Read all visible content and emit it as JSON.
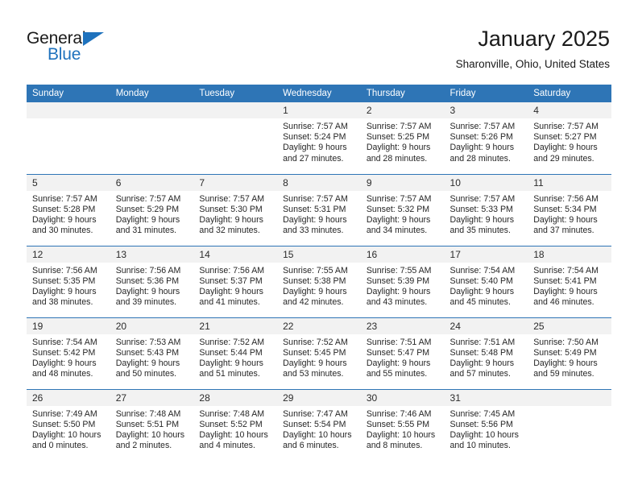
{
  "logo": {
    "word_one": "General",
    "word_two": "Blue",
    "triangle_color": "#1f72bd"
  },
  "header": {
    "title": "January 2025",
    "location": "Sharonville, Ohio, United States"
  },
  "theme": {
    "header_blue": "#2e75b6",
    "daynum_bg": "#f2f2f2",
    "text": "#262626"
  },
  "columns": [
    "Sunday",
    "Monday",
    "Tuesday",
    "Wednesday",
    "Thursday",
    "Friday",
    "Saturday"
  ],
  "weeks": [
    [
      {
        "day": "",
        "empty": true,
        "sunrise": "",
        "sunset": "",
        "daylight_1": "",
        "daylight_2": ""
      },
      {
        "day": "",
        "empty": true,
        "sunrise": "",
        "sunset": "",
        "daylight_1": "",
        "daylight_2": ""
      },
      {
        "day": "",
        "empty": true,
        "sunrise": "",
        "sunset": "",
        "daylight_1": "",
        "daylight_2": ""
      },
      {
        "day": "1",
        "sunrise": "Sunrise: 7:57 AM",
        "sunset": "Sunset: 5:24 PM",
        "daylight_1": "Daylight: 9 hours",
        "daylight_2": "and 27 minutes."
      },
      {
        "day": "2",
        "sunrise": "Sunrise: 7:57 AM",
        "sunset": "Sunset: 5:25 PM",
        "daylight_1": "Daylight: 9 hours",
        "daylight_2": "and 28 minutes."
      },
      {
        "day": "3",
        "sunrise": "Sunrise: 7:57 AM",
        "sunset": "Sunset: 5:26 PM",
        "daylight_1": "Daylight: 9 hours",
        "daylight_2": "and 28 minutes."
      },
      {
        "day": "4",
        "sunrise": "Sunrise: 7:57 AM",
        "sunset": "Sunset: 5:27 PM",
        "daylight_1": "Daylight: 9 hours",
        "daylight_2": "and 29 minutes."
      }
    ],
    [
      {
        "day": "5",
        "sunrise": "Sunrise: 7:57 AM",
        "sunset": "Sunset: 5:28 PM",
        "daylight_1": "Daylight: 9 hours",
        "daylight_2": "and 30 minutes."
      },
      {
        "day": "6",
        "sunrise": "Sunrise: 7:57 AM",
        "sunset": "Sunset: 5:29 PM",
        "daylight_1": "Daylight: 9 hours",
        "daylight_2": "and 31 minutes."
      },
      {
        "day": "7",
        "sunrise": "Sunrise: 7:57 AM",
        "sunset": "Sunset: 5:30 PM",
        "daylight_1": "Daylight: 9 hours",
        "daylight_2": "and 32 minutes."
      },
      {
        "day": "8",
        "sunrise": "Sunrise: 7:57 AM",
        "sunset": "Sunset: 5:31 PM",
        "daylight_1": "Daylight: 9 hours",
        "daylight_2": "and 33 minutes."
      },
      {
        "day": "9",
        "sunrise": "Sunrise: 7:57 AM",
        "sunset": "Sunset: 5:32 PM",
        "daylight_1": "Daylight: 9 hours",
        "daylight_2": "and 34 minutes."
      },
      {
        "day": "10",
        "sunrise": "Sunrise: 7:57 AM",
        "sunset": "Sunset: 5:33 PM",
        "daylight_1": "Daylight: 9 hours",
        "daylight_2": "and 35 minutes."
      },
      {
        "day": "11",
        "sunrise": "Sunrise: 7:56 AM",
        "sunset": "Sunset: 5:34 PM",
        "daylight_1": "Daylight: 9 hours",
        "daylight_2": "and 37 minutes."
      }
    ],
    [
      {
        "day": "12",
        "sunrise": "Sunrise: 7:56 AM",
        "sunset": "Sunset: 5:35 PM",
        "daylight_1": "Daylight: 9 hours",
        "daylight_2": "and 38 minutes."
      },
      {
        "day": "13",
        "sunrise": "Sunrise: 7:56 AM",
        "sunset": "Sunset: 5:36 PM",
        "daylight_1": "Daylight: 9 hours",
        "daylight_2": "and 39 minutes."
      },
      {
        "day": "14",
        "sunrise": "Sunrise: 7:56 AM",
        "sunset": "Sunset: 5:37 PM",
        "daylight_1": "Daylight: 9 hours",
        "daylight_2": "and 41 minutes."
      },
      {
        "day": "15",
        "sunrise": "Sunrise: 7:55 AM",
        "sunset": "Sunset: 5:38 PM",
        "daylight_1": "Daylight: 9 hours",
        "daylight_2": "and 42 minutes."
      },
      {
        "day": "16",
        "sunrise": "Sunrise: 7:55 AM",
        "sunset": "Sunset: 5:39 PM",
        "daylight_1": "Daylight: 9 hours",
        "daylight_2": "and 43 minutes."
      },
      {
        "day": "17",
        "sunrise": "Sunrise: 7:54 AM",
        "sunset": "Sunset: 5:40 PM",
        "daylight_1": "Daylight: 9 hours",
        "daylight_2": "and 45 minutes."
      },
      {
        "day": "18",
        "sunrise": "Sunrise: 7:54 AM",
        "sunset": "Sunset: 5:41 PM",
        "daylight_1": "Daylight: 9 hours",
        "daylight_2": "and 46 minutes."
      }
    ],
    [
      {
        "day": "19",
        "sunrise": "Sunrise: 7:54 AM",
        "sunset": "Sunset: 5:42 PM",
        "daylight_1": "Daylight: 9 hours",
        "daylight_2": "and 48 minutes."
      },
      {
        "day": "20",
        "sunrise": "Sunrise: 7:53 AM",
        "sunset": "Sunset: 5:43 PM",
        "daylight_1": "Daylight: 9 hours",
        "daylight_2": "and 50 minutes."
      },
      {
        "day": "21",
        "sunrise": "Sunrise: 7:52 AM",
        "sunset": "Sunset: 5:44 PM",
        "daylight_1": "Daylight: 9 hours",
        "daylight_2": "and 51 minutes."
      },
      {
        "day": "22",
        "sunrise": "Sunrise: 7:52 AM",
        "sunset": "Sunset: 5:45 PM",
        "daylight_1": "Daylight: 9 hours",
        "daylight_2": "and 53 minutes."
      },
      {
        "day": "23",
        "sunrise": "Sunrise: 7:51 AM",
        "sunset": "Sunset: 5:47 PM",
        "daylight_1": "Daylight: 9 hours",
        "daylight_2": "and 55 minutes."
      },
      {
        "day": "24",
        "sunrise": "Sunrise: 7:51 AM",
        "sunset": "Sunset: 5:48 PM",
        "daylight_1": "Daylight: 9 hours",
        "daylight_2": "and 57 minutes."
      },
      {
        "day": "25",
        "sunrise": "Sunrise: 7:50 AM",
        "sunset": "Sunset: 5:49 PM",
        "daylight_1": "Daylight: 9 hours",
        "daylight_2": "and 59 minutes."
      }
    ],
    [
      {
        "day": "26",
        "sunrise": "Sunrise: 7:49 AM",
        "sunset": "Sunset: 5:50 PM",
        "daylight_1": "Daylight: 10 hours",
        "daylight_2": "and 0 minutes."
      },
      {
        "day": "27",
        "sunrise": "Sunrise: 7:48 AM",
        "sunset": "Sunset: 5:51 PM",
        "daylight_1": "Daylight: 10 hours",
        "daylight_2": "and 2 minutes."
      },
      {
        "day": "28",
        "sunrise": "Sunrise: 7:48 AM",
        "sunset": "Sunset: 5:52 PM",
        "daylight_1": "Daylight: 10 hours",
        "daylight_2": "and 4 minutes."
      },
      {
        "day": "29",
        "sunrise": "Sunrise: 7:47 AM",
        "sunset": "Sunset: 5:54 PM",
        "daylight_1": "Daylight: 10 hours",
        "daylight_2": "and 6 minutes."
      },
      {
        "day": "30",
        "sunrise": "Sunrise: 7:46 AM",
        "sunset": "Sunset: 5:55 PM",
        "daylight_1": "Daylight: 10 hours",
        "daylight_2": "and 8 minutes."
      },
      {
        "day": "31",
        "sunrise": "Sunrise: 7:45 AM",
        "sunset": "Sunset: 5:56 PM",
        "daylight_1": "Daylight: 10 hours",
        "daylight_2": "and 10 minutes."
      },
      {
        "day": "",
        "empty": true,
        "sunrise": "",
        "sunset": "",
        "daylight_1": "",
        "daylight_2": ""
      }
    ]
  ]
}
